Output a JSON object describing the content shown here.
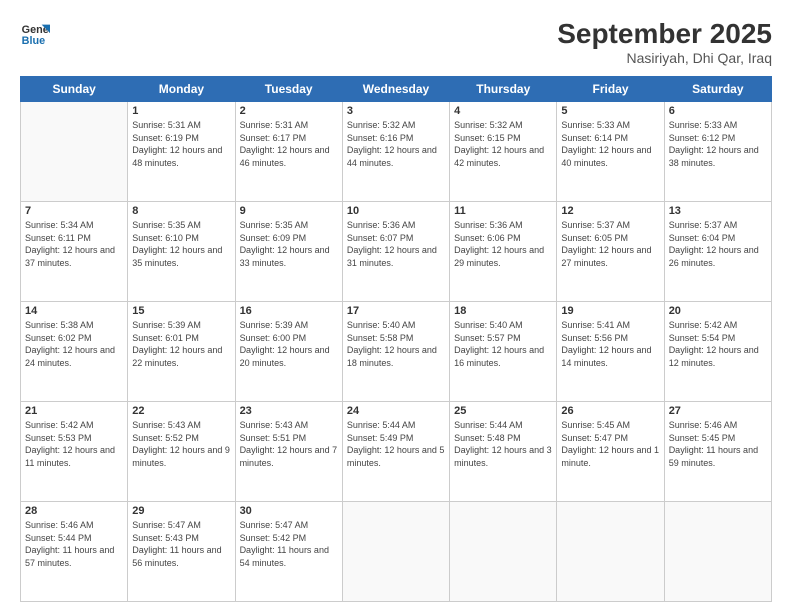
{
  "header": {
    "logo_line1": "General",
    "logo_line2": "Blue",
    "month": "September 2025",
    "location": "Nasiriyah, Dhi Qar, Iraq"
  },
  "weekdays": [
    "Sunday",
    "Monday",
    "Tuesday",
    "Wednesday",
    "Thursday",
    "Friday",
    "Saturday"
  ],
  "weeks": [
    [
      {
        "day": null
      },
      {
        "day": 1,
        "sunrise": "5:31 AM",
        "sunset": "6:19 PM",
        "daylight": "12 hours and 48 minutes."
      },
      {
        "day": 2,
        "sunrise": "5:31 AM",
        "sunset": "6:17 PM",
        "daylight": "12 hours and 46 minutes."
      },
      {
        "day": 3,
        "sunrise": "5:32 AM",
        "sunset": "6:16 PM",
        "daylight": "12 hours and 44 minutes."
      },
      {
        "day": 4,
        "sunrise": "5:32 AM",
        "sunset": "6:15 PM",
        "daylight": "12 hours and 42 minutes."
      },
      {
        "day": 5,
        "sunrise": "5:33 AM",
        "sunset": "6:14 PM",
        "daylight": "12 hours and 40 minutes."
      },
      {
        "day": 6,
        "sunrise": "5:33 AM",
        "sunset": "6:12 PM",
        "daylight": "12 hours and 38 minutes."
      }
    ],
    [
      {
        "day": 7,
        "sunrise": "5:34 AM",
        "sunset": "6:11 PM",
        "daylight": "12 hours and 37 minutes."
      },
      {
        "day": 8,
        "sunrise": "5:35 AM",
        "sunset": "6:10 PM",
        "daylight": "12 hours and 35 minutes."
      },
      {
        "day": 9,
        "sunrise": "5:35 AM",
        "sunset": "6:09 PM",
        "daylight": "12 hours and 33 minutes."
      },
      {
        "day": 10,
        "sunrise": "5:36 AM",
        "sunset": "6:07 PM",
        "daylight": "12 hours and 31 minutes."
      },
      {
        "day": 11,
        "sunrise": "5:36 AM",
        "sunset": "6:06 PM",
        "daylight": "12 hours and 29 minutes."
      },
      {
        "day": 12,
        "sunrise": "5:37 AM",
        "sunset": "6:05 PM",
        "daylight": "12 hours and 27 minutes."
      },
      {
        "day": 13,
        "sunrise": "5:37 AM",
        "sunset": "6:04 PM",
        "daylight": "12 hours and 26 minutes."
      }
    ],
    [
      {
        "day": 14,
        "sunrise": "5:38 AM",
        "sunset": "6:02 PM",
        "daylight": "12 hours and 24 minutes."
      },
      {
        "day": 15,
        "sunrise": "5:39 AM",
        "sunset": "6:01 PM",
        "daylight": "12 hours and 22 minutes."
      },
      {
        "day": 16,
        "sunrise": "5:39 AM",
        "sunset": "6:00 PM",
        "daylight": "12 hours and 20 minutes."
      },
      {
        "day": 17,
        "sunrise": "5:40 AM",
        "sunset": "5:58 PM",
        "daylight": "12 hours and 18 minutes."
      },
      {
        "day": 18,
        "sunrise": "5:40 AM",
        "sunset": "5:57 PM",
        "daylight": "12 hours and 16 minutes."
      },
      {
        "day": 19,
        "sunrise": "5:41 AM",
        "sunset": "5:56 PM",
        "daylight": "12 hours and 14 minutes."
      },
      {
        "day": 20,
        "sunrise": "5:42 AM",
        "sunset": "5:54 PM",
        "daylight": "12 hours and 12 minutes."
      }
    ],
    [
      {
        "day": 21,
        "sunrise": "5:42 AM",
        "sunset": "5:53 PM",
        "daylight": "12 hours and 11 minutes."
      },
      {
        "day": 22,
        "sunrise": "5:43 AM",
        "sunset": "5:52 PM",
        "daylight": "12 hours and 9 minutes."
      },
      {
        "day": 23,
        "sunrise": "5:43 AM",
        "sunset": "5:51 PM",
        "daylight": "12 hours and 7 minutes."
      },
      {
        "day": 24,
        "sunrise": "5:44 AM",
        "sunset": "5:49 PM",
        "daylight": "12 hours and 5 minutes."
      },
      {
        "day": 25,
        "sunrise": "5:44 AM",
        "sunset": "5:48 PM",
        "daylight": "12 hours and 3 minutes."
      },
      {
        "day": 26,
        "sunrise": "5:45 AM",
        "sunset": "5:47 PM",
        "daylight": "12 hours and 1 minute."
      },
      {
        "day": 27,
        "sunrise": "5:46 AM",
        "sunset": "5:45 PM",
        "daylight": "11 hours and 59 minutes."
      }
    ],
    [
      {
        "day": 28,
        "sunrise": "5:46 AM",
        "sunset": "5:44 PM",
        "daylight": "11 hours and 57 minutes."
      },
      {
        "day": 29,
        "sunrise": "5:47 AM",
        "sunset": "5:43 PM",
        "daylight": "11 hours and 56 minutes."
      },
      {
        "day": 30,
        "sunrise": "5:47 AM",
        "sunset": "5:42 PM",
        "daylight": "11 hours and 54 minutes."
      },
      {
        "day": null
      },
      {
        "day": null
      },
      {
        "day": null
      },
      {
        "day": null
      }
    ]
  ]
}
